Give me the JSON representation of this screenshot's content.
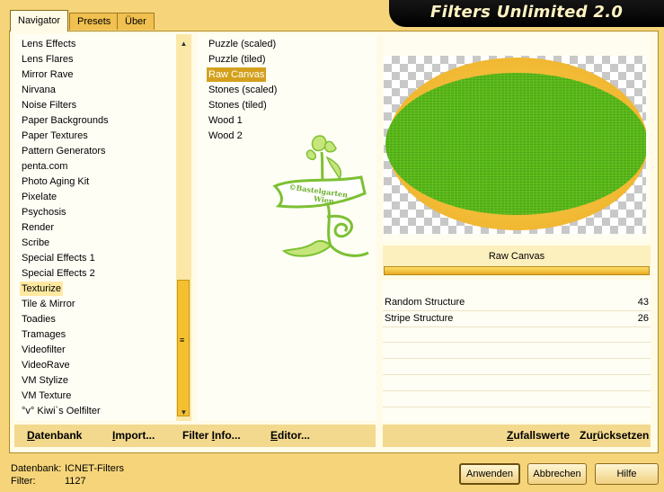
{
  "app": {
    "title": "Filters Unlimited 2.0"
  },
  "tabs": [
    {
      "label": "Navigator",
      "active": true
    },
    {
      "label": "Presets",
      "active": false
    },
    {
      "label": "Über",
      "active": false
    }
  ],
  "categories": {
    "items": [
      "Lens Effects",
      "Lens Flares",
      "Mirror Rave",
      "Nirvana",
      "Noise Filters",
      "Paper Backgrounds",
      "Paper Textures",
      "Pattern Generators",
      "penta.com",
      "Photo Aging Kit",
      "Pixelate",
      "Psychosis",
      "Render",
      "Scribe",
      "Special Effects 1",
      "Special Effects 2",
      "Texturize",
      "Tile & Mirror",
      "Toadies",
      "Tramages",
      "Videofilter",
      "VideoRave",
      "VM Stylize",
      "VM Texture",
      "°v° Kiwi`s Oelfilter"
    ],
    "selected": "Texturize"
  },
  "filters": {
    "items": [
      "Puzzle (scaled)",
      "Puzzle (tiled)",
      "Raw Canvas",
      "Stones (scaled)",
      "Stones (tiled)",
      "Wood 1",
      "Wood 2"
    ],
    "selected": "Raw Canvas"
  },
  "watermark": {
    "line1": "©Bastelgarten",
    "line2": "Wien"
  },
  "preview": {
    "filter_name": "Raw Canvas",
    "progress": 1.0
  },
  "params": [
    {
      "label": "Random Structure",
      "value": "43"
    },
    {
      "label": "Stripe Structure",
      "value": "26"
    }
  ],
  "left_buttons": {
    "datenbank": {
      "accel": "D",
      "rest": "atenbank"
    },
    "import": {
      "accel": "I",
      "rest": "mport..."
    },
    "filter_info": {
      "pre": "Filter ",
      "accel": "I",
      "rest": "nfo..."
    },
    "editor": {
      "accel": "E",
      "rest": "ditor..."
    }
  },
  "right_buttons": {
    "zufallswerte": {
      "accel": "Z",
      "rest": "ufallswerte"
    },
    "zuruecksetzen": {
      "pre": "Zu",
      "accel": "r",
      "rest": "ücksetzen"
    }
  },
  "status": {
    "datenbank_label": "Datenbank:",
    "datenbank_value": "ICNET-Filters",
    "filter_label": "Filter:",
    "filter_value": "1127"
  },
  "dialog_buttons": {
    "apply": "Anwenden",
    "cancel": "Abbrechen",
    "help": "Hilfe"
  },
  "colors": {
    "accent": "#d4a01c",
    "frame": "#f6d57a",
    "preview_green": "#58b818",
    "preview_gold": "#f1b832"
  }
}
